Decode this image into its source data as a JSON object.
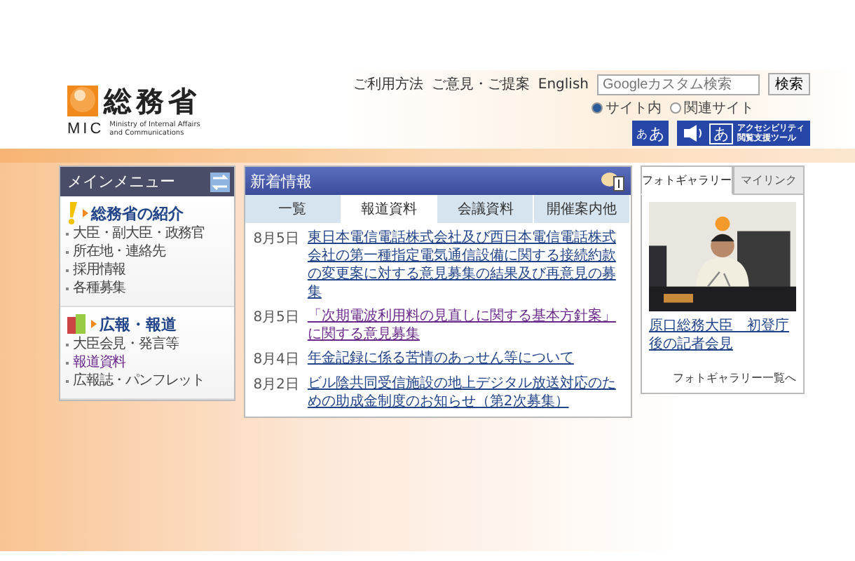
{
  "header": {
    "logo": {
      "name": "総務省",
      "abbr": "MIC",
      "english": [
        "Ministry of Internal Affairs",
        "and Communications"
      ]
    },
    "links": [
      "ご利用方法",
      "ご意見・ご提案",
      "English"
    ],
    "search": {
      "placeholder": "Googleカスタム検索",
      "button": "検索"
    },
    "scope": [
      {
        "label": "サイト内",
        "selected": true
      },
      {
        "label": "関連サイト",
        "selected": false
      }
    ],
    "tools": {
      "font_size": [
        "あ",
        "あ"
      ],
      "reader": "あ",
      "accessibility": [
        "アクセシビリティ",
        "閲覧支援ツール"
      ]
    }
  },
  "main_menu": {
    "title": "メインメニュー",
    "sections": [
      {
        "title": "総務省の紹介",
        "items": [
          {
            "label": "大臣・副大臣・政務官",
            "visited": false
          },
          {
            "label": "所在地・連絡先",
            "visited": false
          },
          {
            "label": "採用情報",
            "visited": false
          },
          {
            "label": "各種募集",
            "visited": false
          }
        ]
      },
      {
        "title": "広報・報道",
        "items": [
          {
            "label": "大臣会見・発言等",
            "visited": false
          },
          {
            "label": "報道資料",
            "visited": true
          },
          {
            "label": "広報誌・パンフレット",
            "visited": false
          }
        ]
      }
    ]
  },
  "news": {
    "title": "新着情報",
    "tabs": [
      {
        "label": "一覧",
        "selected": false
      },
      {
        "label": "報道資料",
        "selected": true
      },
      {
        "label": "会議資料",
        "selected": false
      },
      {
        "label": "開催案内他",
        "selected": false
      }
    ],
    "items": [
      {
        "date": "8月5日",
        "text": "東日本電信電話株式会社及び西日本電信電話株式会社の第一種指定電気通信設備に関する接続約款の変更案に対する意見募集の結果及び再意見の募集",
        "visited": false
      },
      {
        "date": "8月5日",
        "text": "「次期電波利用料の見直しに関する基本方針案」に関する意見募集",
        "visited": true
      },
      {
        "date": "8月4日",
        "text": "年金記録に係る苦情のあっせん等について",
        "visited": false
      },
      {
        "date": "8月2日",
        "text": "ビル陰共同受信施設の地上デジタル放送対応のための助成金制度のお知らせ（第2次募集）",
        "visited": false
      }
    ]
  },
  "gallery": {
    "tabs": [
      {
        "label": "フォトギャラリー",
        "selected": true
      },
      {
        "label": "マイリンク",
        "selected": false
      }
    ],
    "caption": "原口総務大臣　初登庁後の記者会見",
    "more": "フォトギャラリー一覧へ"
  }
}
